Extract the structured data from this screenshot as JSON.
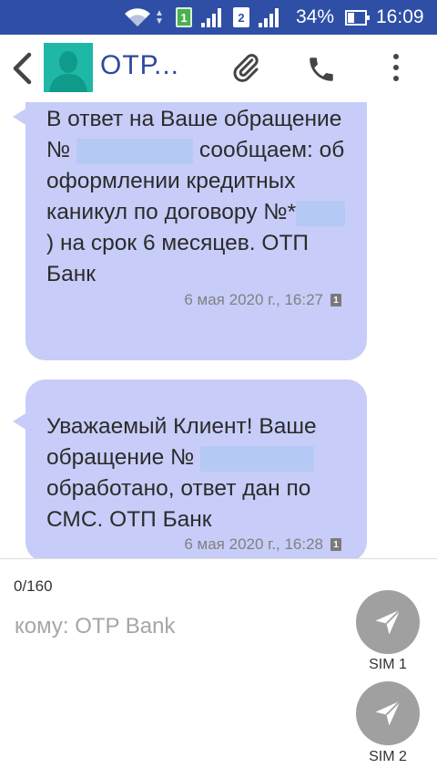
{
  "status_bar": {
    "sim1_label": "1",
    "sim2_label": "2",
    "battery_percent_text": "34%",
    "battery_level": 0.34,
    "time": "16:09",
    "color": "#2f4fa6",
    "icons": [
      "wifi-icon",
      "data-arrows-icon",
      "sim1-icon",
      "signal-icon",
      "sim2-icon",
      "signal-icon",
      "battery-icon"
    ]
  },
  "app_bar": {
    "contact_name": "ОТР...",
    "avatar_color": "#1fb8a7",
    "icons": [
      "back-icon",
      "attach-icon",
      "call-icon",
      "more-icon"
    ]
  },
  "messages": [
    {
      "parts": [
        "В ответ на Ваше обращение № ",
        " сообщаем: об оформлении кредитных каникул по договору №*",
        ") на срок 6 месяцев. ОТП Банк"
      ],
      "timestamp": "6 мая 2020 г., 16:27",
      "sim": "1"
    },
    {
      "parts": [
        "Уважаемый Клиент! Ваше обращение № ",
        " обработано, ответ дан по СМС. ОТП Банк"
      ],
      "timestamp": "6 мая 2020 г., 16:28",
      "sim": "1"
    }
  ],
  "bubble_color": "#c7cdf8",
  "composer": {
    "char_count": "0/160",
    "recipient_placeholder": "кому: OTP Bank",
    "send_sim1_label": "SIM 1",
    "send_sim2_label": "SIM 2",
    "send_icon": "send-icon"
  }
}
